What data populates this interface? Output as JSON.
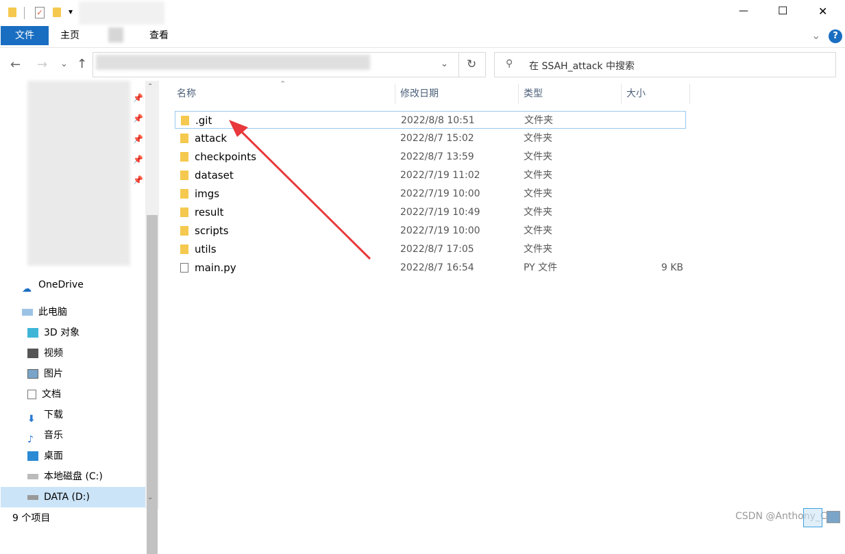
{
  "window": {
    "minimize": "—",
    "maximize": "☐",
    "close": "✕",
    "qat_dropdown": "▾"
  },
  "ribbon": {
    "tabs": [
      "文件",
      "主页",
      "查看"
    ],
    "help": "?",
    "expand": "⌄"
  },
  "nav": {
    "back": "←",
    "forward": "→",
    "recent": "⌄",
    "up": "↑",
    "address_dropdown": "⌄",
    "refresh": "↻"
  },
  "search": {
    "placeholder": "在 SSAH_attack 中搜索"
  },
  "sidebar": {
    "items": [
      {
        "label": "OneDrive",
        "icon": "cloud-icon"
      },
      {
        "label": "此电脑",
        "icon": "computer-icon"
      },
      {
        "label": "3D 对象",
        "icon": "cube-icon"
      },
      {
        "label": "视频",
        "icon": "video-icon"
      },
      {
        "label": "图片",
        "icon": "picture-icon"
      },
      {
        "label": "文档",
        "icon": "document-icon"
      },
      {
        "label": "下载",
        "icon": "download-icon"
      },
      {
        "label": "音乐",
        "icon": "music-icon"
      },
      {
        "label": "桌面",
        "icon": "desktop-icon"
      },
      {
        "label": "本地磁盘 (C:)",
        "icon": "drive-icon"
      },
      {
        "label": "DATA (D:)",
        "icon": "drive-icon"
      }
    ]
  },
  "columns": [
    "名称",
    "修改日期",
    "类型",
    "大小"
  ],
  "files": [
    {
      "name": ".git",
      "date": "2022/8/8 10:51",
      "type": "文件夹",
      "size": ""
    },
    {
      "name": "attack",
      "date": "2022/8/7 15:02",
      "type": "文件夹",
      "size": ""
    },
    {
      "name": "checkpoints",
      "date": "2022/8/7 13:59",
      "type": "文件夹",
      "size": ""
    },
    {
      "name": "dataset",
      "date": "2022/7/19 11:02",
      "type": "文件夹",
      "size": ""
    },
    {
      "name": "imgs",
      "date": "2022/7/19 10:00",
      "type": "文件夹",
      "size": ""
    },
    {
      "name": "result",
      "date": "2022/7/19 10:49",
      "type": "文件夹",
      "size": ""
    },
    {
      "name": "scripts",
      "date": "2022/7/19 10:00",
      "type": "文件夹",
      "size": ""
    },
    {
      "name": "utils",
      "date": "2022/8/7 17:05",
      "type": "文件夹",
      "size": ""
    },
    {
      "name": "main.py",
      "date": "2022/8/7 16:54",
      "type": "PY 文件",
      "size": "9 KB"
    }
  ],
  "status": {
    "count": "9 个项目"
  },
  "watermark": "CSDN @Anthony_CH",
  "colors": {
    "accent": "#1a6ec1",
    "arrow": "#e8383b",
    "selection_border": "#99c9ef"
  }
}
